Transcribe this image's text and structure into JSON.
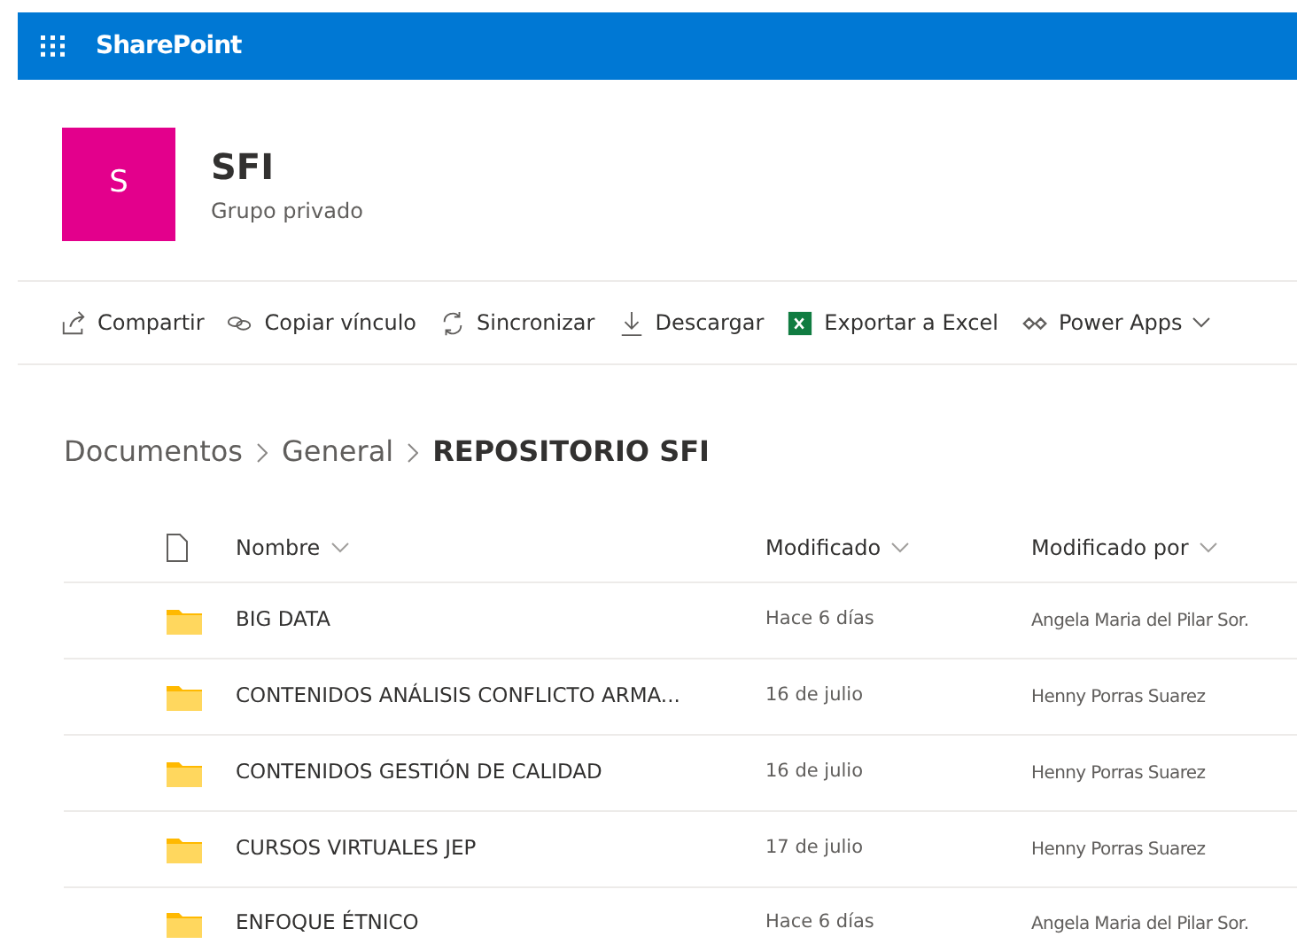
{
  "app_bar": {
    "title": "SharePoint"
  },
  "site": {
    "logo_letter": "S",
    "title": "SFI",
    "subtitle": "Grupo privado"
  },
  "toolbar": [
    {
      "label": "Compartir"
    },
    {
      "label": "Copiar vínculo"
    },
    {
      "label": "Sincronizar"
    },
    {
      "label": "Descargar"
    },
    {
      "label": "Exportar a Excel"
    },
    {
      "label": "Power Apps"
    }
  ],
  "breadcrumb": [
    "Documentos",
    "General",
    "REPOSITORIO SFI"
  ],
  "table": {
    "columns": [
      "Nombre",
      "Modificado",
      "Modificado por"
    ],
    "rows": [
      {
        "name": "BIG DATA",
        "modified": "Hace 6 días",
        "modified_by": "Angela Maria del Pilar Sor."
      },
      {
        "name": "CONTENIDOS ANÁLISIS CONFLICTO ARMA...",
        "modified": "16 de julio",
        "modified_by": "Henny Porras Suarez"
      },
      {
        "name": "CONTENIDOS GESTIÓN DE CALIDAD",
        "modified": "16 de julio",
        "modified_by": "Henny Porras Suarez"
      },
      {
        "name": "CURSOS VIRTUALES JEP",
        "modified": "17 de julio",
        "modified_by": "Henny Porras Suarez"
      },
      {
        "name": "ENFOQUE ÉTNICO",
        "modified": "Hace 6 días",
        "modified_by": "Angela Maria del Pilar Sor."
      }
    ]
  }
}
